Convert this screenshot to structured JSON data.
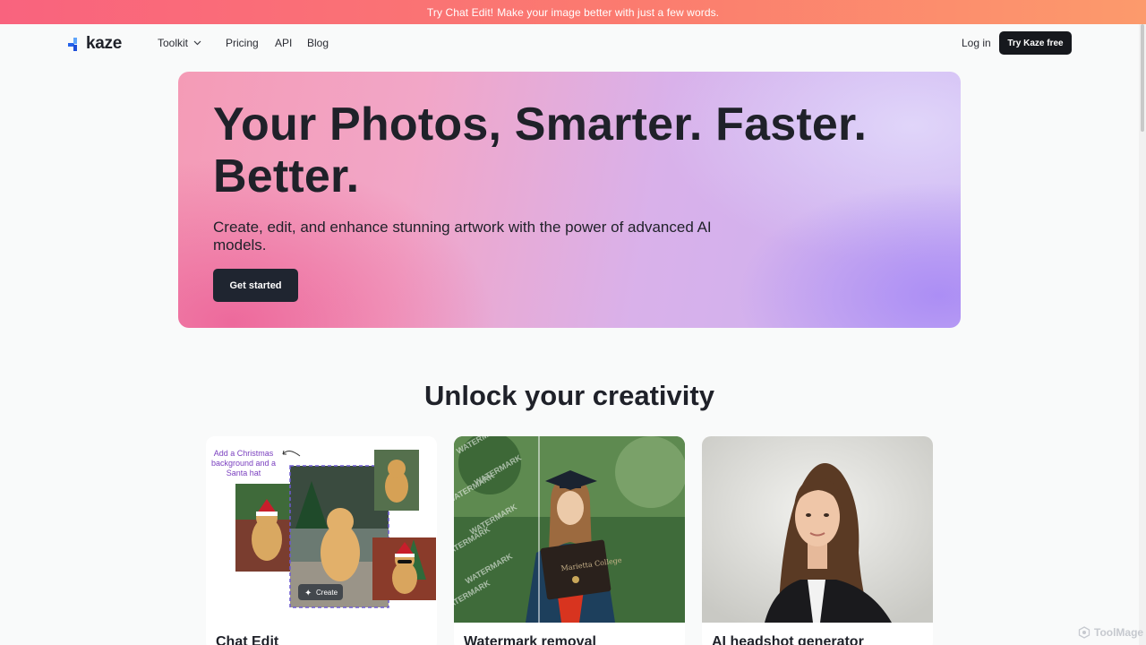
{
  "colors": {
    "announce_start": "#f9637e",
    "announce_end": "#fc9a6c",
    "dark_button": "#16181d",
    "text": "#1f2129",
    "logo_blue": "#2563eb"
  },
  "announcement": {
    "lead": "Try Chat Edit!",
    "text": "Make your image better with just a few words."
  },
  "header": {
    "logo_text": "kaze",
    "nav": {
      "toolkit": "Toolkit",
      "pricing": "Pricing",
      "api": "API",
      "blog": "Blog"
    },
    "login": "Log in",
    "try_button": "Try Kaze free"
  },
  "hero": {
    "title": "Your Photos, Smarter. Faster. Better.",
    "subtitle": "Create, edit, and enhance stunning artwork with the power of advanced AI models.",
    "cta": "Get started"
  },
  "section": {
    "title": "Unlock your creativity"
  },
  "cards": [
    {
      "title": "Chat Edit",
      "caption": "Add a Christmas background and a Santa hat",
      "create_button": "Create"
    },
    {
      "title": "Watermark removal",
      "watermark": "WATERMARK",
      "diploma": "Marietta College"
    },
    {
      "title": "AI headshot generator"
    }
  ],
  "watermark_brand": "ToolMage",
  "icons": {
    "logo": "kaze-logo-icon",
    "toolkit_chevron": "chevron-down-icon",
    "sparkle": "sparkle-icon",
    "arrow": "curved-arrow-icon"
  }
}
